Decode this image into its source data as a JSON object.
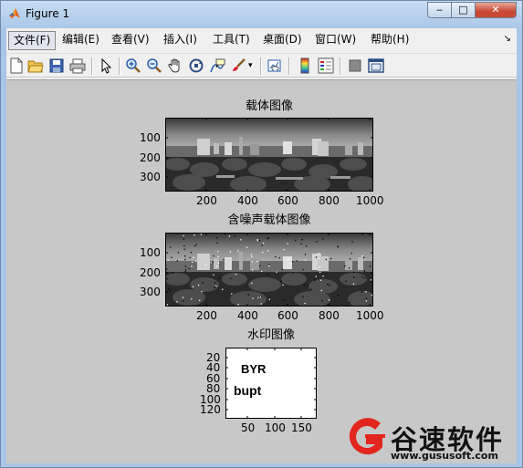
{
  "window": {
    "title": "Figure 1",
    "buttons": {
      "minimize": "‒",
      "maximize": "□",
      "close": "✕"
    }
  },
  "menu": {
    "items": [
      "文件(F)",
      "编辑(E)",
      "查看(V)",
      "插入(I)",
      "工具(T)",
      "桌面(D)",
      "窗口(W)",
      "帮助(H)"
    ],
    "overflow": "↘"
  },
  "toolbar": {
    "icons": [
      "new-figure-icon",
      "open-file-icon",
      "save-icon",
      "print-icon",
      "pointer-icon",
      "zoom-in-icon",
      "zoom-out-icon",
      "pan-icon",
      "rotate-3d-icon",
      "data-cursor-icon",
      "brush-icon",
      "link-plot-icon",
      "colorbar-icon",
      "legend-icon",
      "hide-plot-tools-icon",
      "show-plot-tools-icon"
    ]
  },
  "plots": {
    "carrier": {
      "title": "载体图像",
      "yticks": [
        "100",
        "200",
        "300"
      ],
      "xticks": [
        "200",
        "400",
        "600",
        "800",
        "1000"
      ]
    },
    "noisy": {
      "title": "含噪声载体图像",
      "yticks": [
        "100",
        "200",
        "300"
      ],
      "xticks": [
        "200",
        "400",
        "600",
        "800",
        "1000"
      ]
    },
    "watermark": {
      "title": "水印图像",
      "yticks": [
        "20",
        "40",
        "60",
        "80",
        "100",
        "120"
      ],
      "xticks": [
        "50",
        "100",
        "150"
      ],
      "text_line1": "BYR",
      "text_line2": "bupt"
    }
  },
  "brand": {
    "name": "谷速软件",
    "url": "www.gususoft.com"
  }
}
